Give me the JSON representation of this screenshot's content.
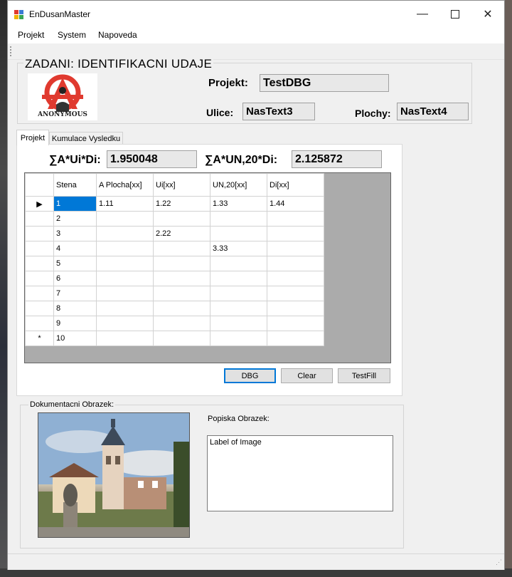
{
  "window": {
    "title": "EnDusanMaster",
    "minimize_icon": "minimize-icon",
    "maximize_icon": "maximize-icon",
    "close_icon": "close-icon"
  },
  "menu": [
    "Projekt",
    "System",
    "Napoveda"
  ],
  "zadani": {
    "legend": "ZADANI: IDENTIFIKACNI  UDAJE",
    "logo_text": "ANONYMOUS",
    "projekt_label": "Projekt:",
    "projekt_value": "TestDBG",
    "ulice_label": "Ulice:",
    "ulice_value": "NasText3",
    "plochy_label": "Plochy:",
    "plochy_value": "NasText4"
  },
  "tabs": [
    "Projekt",
    "Kumulace Vysledku"
  ],
  "sums": {
    "aui_label": "∑A*Ui*Di:",
    "aui_value": "1.950048",
    "aun_label": "∑A*UN,20*Di:",
    "aun_value": "2.125872"
  },
  "grid": {
    "columns": [
      "Stena",
      "A Plocha[xx]",
      "Ui[xx]",
      "UN,20[xx]",
      "Di[xx]"
    ],
    "rows": [
      [
        "1",
        "1.11",
        "1.22",
        "1.33",
        "1.44"
      ],
      [
        "2",
        "",
        "",
        "",
        ""
      ],
      [
        "3",
        "",
        "2.22",
        "",
        ""
      ],
      [
        "4",
        "",
        "",
        "3.33",
        ""
      ],
      [
        "5",
        "",
        "",
        "",
        ""
      ],
      [
        "6",
        "",
        "",
        "",
        ""
      ],
      [
        "7",
        "",
        "",
        "",
        ""
      ],
      [
        "8",
        "",
        "",
        "",
        ""
      ],
      [
        "9",
        "",
        "",
        "",
        ""
      ],
      [
        "10",
        "",
        "",
        "",
        ""
      ]
    ],
    "current_row_marker": "▶",
    "new_row_marker": "*"
  },
  "buttons": {
    "dbg": "DBG",
    "clear": "Clear",
    "testfill": "TestFill"
  },
  "dokumentace": {
    "legend": "Dokumentacni Obrazek:",
    "popiska_label": "Popiska Obrazek:",
    "popiska_text": "Label of Image"
  },
  "colors": {
    "selection": "#0078d7",
    "logo_red": "#e03a2f"
  }
}
